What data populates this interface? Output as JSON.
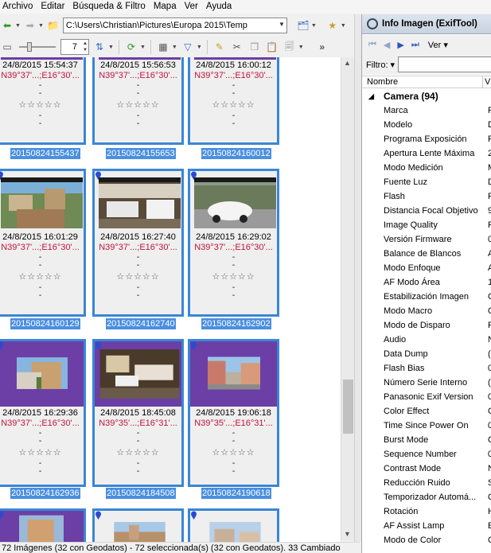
{
  "menu": [
    "Archivo",
    "Editar",
    "Búsqueda & Filtro",
    "Mapa",
    "Ver",
    "Ayuda"
  ],
  "toolbar": {
    "path": "C:\\Users\\Christian\\Pictures\\Europa 2015\\Temp",
    "zoom_value": "7"
  },
  "thumbnails": [
    {
      "date": "24/8/2015 15:54:37",
      "coord": "N39°37'...;E16°30'...",
      "file": "20150824155437"
    },
    {
      "date": "24/8/2015 15:56:53",
      "coord": "N39°37'...;E16°30'...",
      "file": "20150824155653"
    },
    {
      "date": "24/8/2015 16:00:12",
      "coord": "N39°37'...;E16°30'...",
      "file": "20150824160012"
    },
    {
      "date": "24/8/2015 16:01:29",
      "coord": "N39°37'...;E16°30'...",
      "file": "20150824160129"
    },
    {
      "date": "24/8/2015 16:27:40",
      "coord": "N39°37'...;E16°30'...",
      "file": "20150824162740"
    },
    {
      "date": "24/8/2015 16:29:02",
      "coord": "N39°37'...;E16°30'...",
      "file": "20150824162902"
    },
    {
      "date": "24/8/2015 16:29:36",
      "coord": "N39°37'...;E16°30'...",
      "file": "20150824162936"
    },
    {
      "date": "24/8/2015 18:45:08",
      "coord": "N39°35'...;E16°31'...",
      "file": "20150824184508"
    },
    {
      "date": "24/8/2015 19:06:18",
      "coord": "N39°35'...;E16°31'...",
      "file": "20150824190618"
    }
  ],
  "dash": "-",
  "stars": "☆☆☆☆☆",
  "status": "72 Imágenes (32 con Geodatos) - 72 seleccionada(s) (32 con Geodatos). 33 Cambiado",
  "panel": {
    "title": "Info Imagen (ExifTool)",
    "ver_label": "Ver",
    "filter_label": "Filtro:",
    "col_name": "Nombre",
    "col_value": "V",
    "group": "Camera (94)",
    "rows": [
      {
        "k": "Marca",
        "v": "P"
      },
      {
        "k": "Modelo",
        "v": "D"
      },
      {
        "k": "Programa Exposición",
        "v": "P"
      },
      {
        "k": "Apertura Lente Máxima",
        "v": "2"
      },
      {
        "k": "Modo Medición",
        "v": "M"
      },
      {
        "k": "Fuente Luz",
        "v": "D"
      },
      {
        "k": "Flash",
        "v": "F"
      },
      {
        "k": "Distancia Focal Objetivo",
        "v": "9"
      },
      {
        "k": "Image Quality",
        "v": "F"
      },
      {
        "k": "Versión Firmware",
        "v": "0"
      },
      {
        "k": "Balance de Blancos",
        "v": "A"
      },
      {
        "k": "Modo Enfoque",
        "v": "A"
      },
      {
        "k": "AF Modo Área",
        "v": "1"
      },
      {
        "k": "Estabilización Imagen",
        "v": "O"
      },
      {
        "k": "Modo Macro",
        "v": "O"
      },
      {
        "k": "Modo de Disparo",
        "v": "P"
      },
      {
        "k": "Audio",
        "v": "N"
      },
      {
        "k": "Data Dump",
        "v": "("
      },
      {
        "k": "Flash Bias",
        "v": "0"
      },
      {
        "k": "Número Serie Interno",
        "v": "("
      },
      {
        "k": "Panasonic Exif Version",
        "v": "0"
      },
      {
        "k": "Color Effect",
        "v": "O"
      },
      {
        "k": "Time Since Power On",
        "v": "0"
      },
      {
        "k": "Burst Mode",
        "v": "O"
      },
      {
        "k": "Sequence Number",
        "v": "0"
      },
      {
        "k": "Contrast Mode",
        "v": "N"
      },
      {
        "k": "Reducción Ruido",
        "v": "S"
      },
      {
        "k": "Temporizador Automá...",
        "v": "O"
      },
      {
        "k": "Rotación",
        "v": "H"
      },
      {
        "k": "AF Assist Lamp",
        "v": "E"
      },
      {
        "k": "Modo de Color",
        "v": "C"
      }
    ]
  }
}
